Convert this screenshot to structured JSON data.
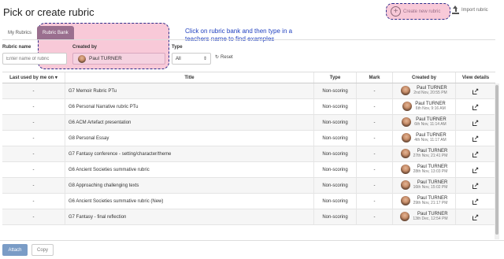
{
  "header": {
    "title": "Pick or create rubric",
    "create_label": "Create new rubric",
    "import_label": "Import rubric"
  },
  "annotation": "Click on rubric bank and then type in a teachers name to find examples",
  "tabs": [
    "My Rubrics",
    "Rubric Bank"
  ],
  "filters": {
    "name_label": "Rubric name",
    "name_placeholder": "Enter name of rubric",
    "created_by_label": "Created by",
    "created_by_value": "Paul TURNER",
    "type_label": "Type",
    "type_value": "All",
    "reset_label": "Reset"
  },
  "table": {
    "columns": [
      "Last used by me on",
      "Title",
      "Type",
      "Mark",
      "Created by",
      "View details"
    ],
    "rows": [
      {
        "last": "-",
        "title": "G7 Memoir Rubric PTu",
        "type": "Non-scoring",
        "mark": "-",
        "name": "Paul TURNER",
        "date": "2nd Nov, 20:55 PM"
      },
      {
        "last": "-",
        "title": "G6 Personal Narrative rubric PTu",
        "type": "Non-scoring",
        "mark": "-",
        "name": "Paul TURNER",
        "date": "6th Nov, 9:16 AM"
      },
      {
        "last": "-",
        "title": "G6 ACM Artefact presentation",
        "type": "Non-scoring",
        "mark": "-",
        "name": "Paul TURNER",
        "date": "6th Nov, 11:14 AM"
      },
      {
        "last": "-",
        "title": "G8 Personal Essay",
        "type": "Non-scoring",
        "mark": "-",
        "name": "Paul TURNER",
        "date": "4th Nov, 11:17 AM"
      },
      {
        "last": "-",
        "title": "G7 Fantasy conference - setting/character/theme",
        "type": "Non-scoring",
        "mark": "-",
        "name": "Paul TURNER",
        "date": "27th Nov, 21:41 PM"
      },
      {
        "last": "-",
        "title": "G6 Ancient Societies summative rubric",
        "type": "Non-scoring",
        "mark": "-",
        "name": "Paul TURNER",
        "date": "28th Nov, 13:03 PM"
      },
      {
        "last": "-",
        "title": "G8 Approaching challenging texts",
        "type": "Non-scoring",
        "mark": "-",
        "name": "Paul TURNER",
        "date": "16th Nov, 15:02 PM"
      },
      {
        "last": "-",
        "title": "G6 Ancient Societies summative rubric (New)",
        "type": "Non-scoring",
        "mark": "-",
        "name": "Paul TURNER",
        "date": "29th Nov, 21:17 PM"
      },
      {
        "last": "-",
        "title": "G7 Fantasy - final reflection",
        "type": "Non-scoring",
        "mark": "-",
        "name": "Paul TURNER",
        "date": "13th Dec, 12:54 PM"
      }
    ]
  },
  "footer": {
    "attach_label": "Attach",
    "copy_label": "Copy"
  },
  "colors": {
    "highlight": "#f8c9d8",
    "tab_active": "#9a6f8f",
    "attach": "#7a9cc6",
    "annotation": "#1f3fbf"
  }
}
